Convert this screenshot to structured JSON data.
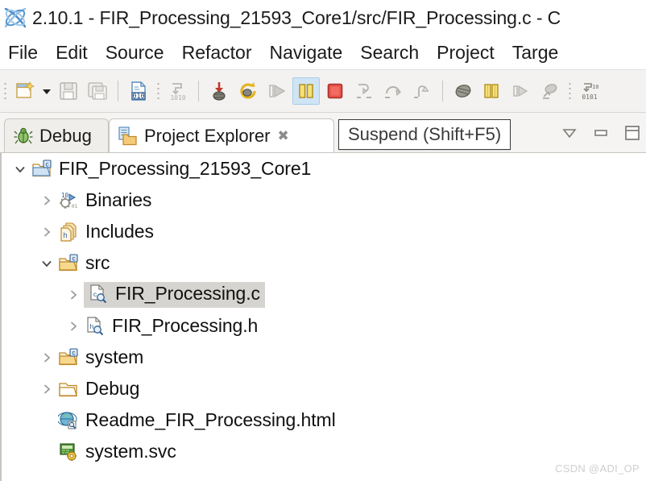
{
  "window": {
    "app_icon": "crosscore-logo-icon",
    "title": "2.10.1 - FIR_Processing_21593_Core1/src/FIR_Processing.c - C"
  },
  "menubar": {
    "items": [
      {
        "label": "File",
        "name": "menu-file"
      },
      {
        "label": "Edit",
        "name": "menu-edit"
      },
      {
        "label": "Source",
        "name": "menu-source"
      },
      {
        "label": "Refactor",
        "name": "menu-refactor"
      },
      {
        "label": "Navigate",
        "name": "menu-navigate"
      },
      {
        "label": "Search",
        "name": "menu-search"
      },
      {
        "label": "Project",
        "name": "menu-project"
      },
      {
        "label": "Targe",
        "name": "menu-target"
      }
    ]
  },
  "toolbar": {
    "buttons": [
      {
        "icon": "new-file-icon",
        "state": "enabled"
      },
      {
        "icon": "dropdown-arrow-icon",
        "state": "enabled"
      },
      {
        "icon": "save-icon",
        "state": "disabled"
      },
      {
        "icon": "save-all-icon",
        "state": "disabled"
      },
      {
        "icon": "build-binary-icon",
        "state": "enabled"
      },
      {
        "icon": "build-all-icon",
        "state": "disabled"
      },
      {
        "icon": "debug-icon",
        "state": "enabled"
      },
      {
        "icon": "refresh-icon",
        "state": "enabled"
      },
      {
        "icon": "resume-icon",
        "state": "disabled"
      },
      {
        "icon": "suspend-icon",
        "state": "active"
      },
      {
        "icon": "terminate-icon",
        "state": "enabled"
      },
      {
        "icon": "step-into-icon",
        "state": "disabled"
      },
      {
        "icon": "step-over-icon",
        "state": "disabled"
      },
      {
        "icon": "step-return-icon",
        "state": "disabled"
      },
      {
        "icon": "processor-icon",
        "state": "enabled"
      },
      {
        "icon": "memory-icon",
        "state": "enabled"
      },
      {
        "icon": "run-to-line-icon",
        "state": "disabled"
      },
      {
        "icon": "disassembly-icon",
        "state": "disabled"
      },
      {
        "icon": "registers-icon",
        "state": "enabled"
      }
    ]
  },
  "tabs": [
    {
      "label": "Debug",
      "icon": "bug-icon",
      "active": false,
      "closable": false
    },
    {
      "label": "Project Explorer",
      "icon": "project-explorer-icon",
      "active": true,
      "closable": true,
      "close_glyph": "✖"
    }
  ],
  "view_tools": [
    {
      "name": "view-menu-button",
      "icon": "chevron-down-icon"
    },
    {
      "name": "minimize-view-button",
      "icon": "minimize-icon"
    },
    {
      "name": "maximize-view-button",
      "icon": "maximize-icon"
    }
  ],
  "tooltip": {
    "text": "Suspend (Shift+F5)"
  },
  "tree": {
    "nodes": [
      {
        "label": "FIR_Processing_21593_Core1",
        "icon": "c-project-folder-icon",
        "twisty": "expanded",
        "indent": 0,
        "selected": false
      },
      {
        "label": "Binaries",
        "icon": "binaries-icon",
        "twisty": "collapsed",
        "indent": 1,
        "selected": false
      },
      {
        "label": "Includes",
        "icon": "includes-icon",
        "twisty": "collapsed",
        "indent": 1,
        "selected": false
      },
      {
        "label": "src",
        "icon": "source-folder-icon",
        "twisty": "expanded",
        "indent": 1,
        "selected": false
      },
      {
        "label": "FIR_Processing.c",
        "icon": "c-source-file-icon",
        "twisty": "collapsed",
        "indent": 2,
        "selected": true
      },
      {
        "label": "FIR_Processing.h",
        "icon": "h-header-file-icon",
        "twisty": "collapsed",
        "indent": 2,
        "selected": false
      },
      {
        "label": "system",
        "icon": "c-folder-icon",
        "twisty": "collapsed",
        "indent": 1,
        "selected": false
      },
      {
        "label": "Debug",
        "icon": "plain-folder-icon",
        "twisty": "collapsed",
        "indent": 1,
        "selected": false
      },
      {
        "label": "Readme_FIR_Processing.html",
        "icon": "html-file-icon",
        "twisty": "none",
        "indent": 1,
        "selected": false
      },
      {
        "label": "system.svc",
        "icon": "svc-file-icon",
        "twisty": "none",
        "indent": 1,
        "selected": false
      }
    ]
  },
  "watermark": {
    "text": "CSDN @ADI_OP"
  },
  "colors": {
    "selection": "#d6d4d0",
    "toolbar_active": "#cfe4f5",
    "folder": "#f0c070",
    "panel_bg": "#f5f4f2"
  }
}
